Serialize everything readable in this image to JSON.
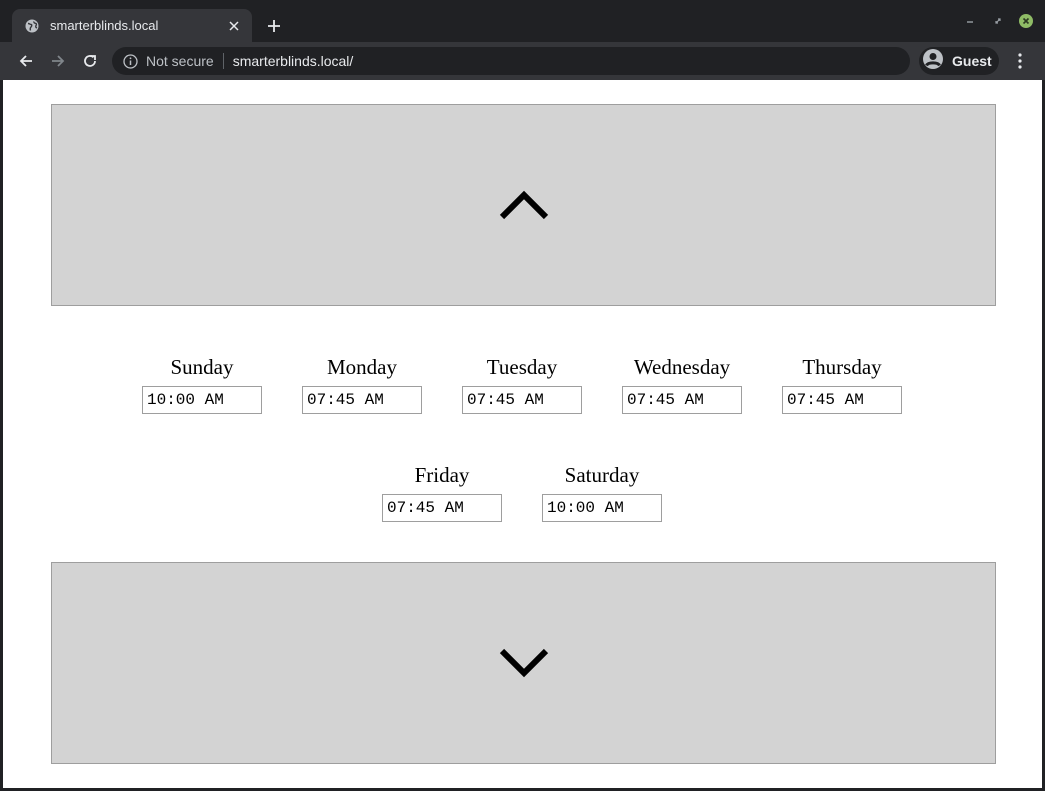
{
  "browser": {
    "tab_title": "smarterblinds.local",
    "security_label": "Not secure",
    "url": "smarterblinds.local/",
    "profile_label": "Guest"
  },
  "controls": {
    "up_icon": "chevron-up-icon",
    "down_icon": "chevron-down-icon"
  },
  "schedule": [
    {
      "day": "Sunday",
      "time": "10:00 AM"
    },
    {
      "day": "Monday",
      "time": "07:45 AM"
    },
    {
      "day": "Tuesday",
      "time": "07:45 AM"
    },
    {
      "day": "Wednesday",
      "time": "07:45 AM"
    },
    {
      "day": "Thursday",
      "time": "07:45 AM"
    },
    {
      "day": "Friday",
      "time": "07:45 AM"
    },
    {
      "day": "Saturday",
      "time": "10:00 AM"
    }
  ],
  "colors": {
    "button_bg": "#d3d3d3",
    "chrome_bg": "#202124",
    "toolbar_bg": "#35363a",
    "close_button": "#8fbc66"
  }
}
